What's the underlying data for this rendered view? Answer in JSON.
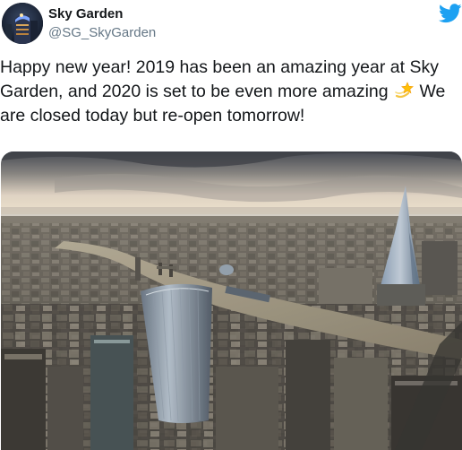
{
  "tweet": {
    "author": {
      "display_name": "Sky Garden",
      "handle": "@SG_SkyGarden",
      "avatar_icon": "avatar-photo"
    },
    "platform_icon": "twitter-bird-icon",
    "text_before_emoji": "Happy new year! 2019 has been an amazing year at Sky Garden, and 2020 is set to be even more amazing",
    "emoji_icon": "dizzy-star-emoji",
    "text_after_emoji": "We are closed today but re-open tomorrow!",
    "media": {
      "type": "photo",
      "subject": "aerial-london-skyline"
    },
    "colors": {
      "brand": "#1da1f2",
      "text": "#14171a",
      "secondary_text": "#657786"
    }
  }
}
